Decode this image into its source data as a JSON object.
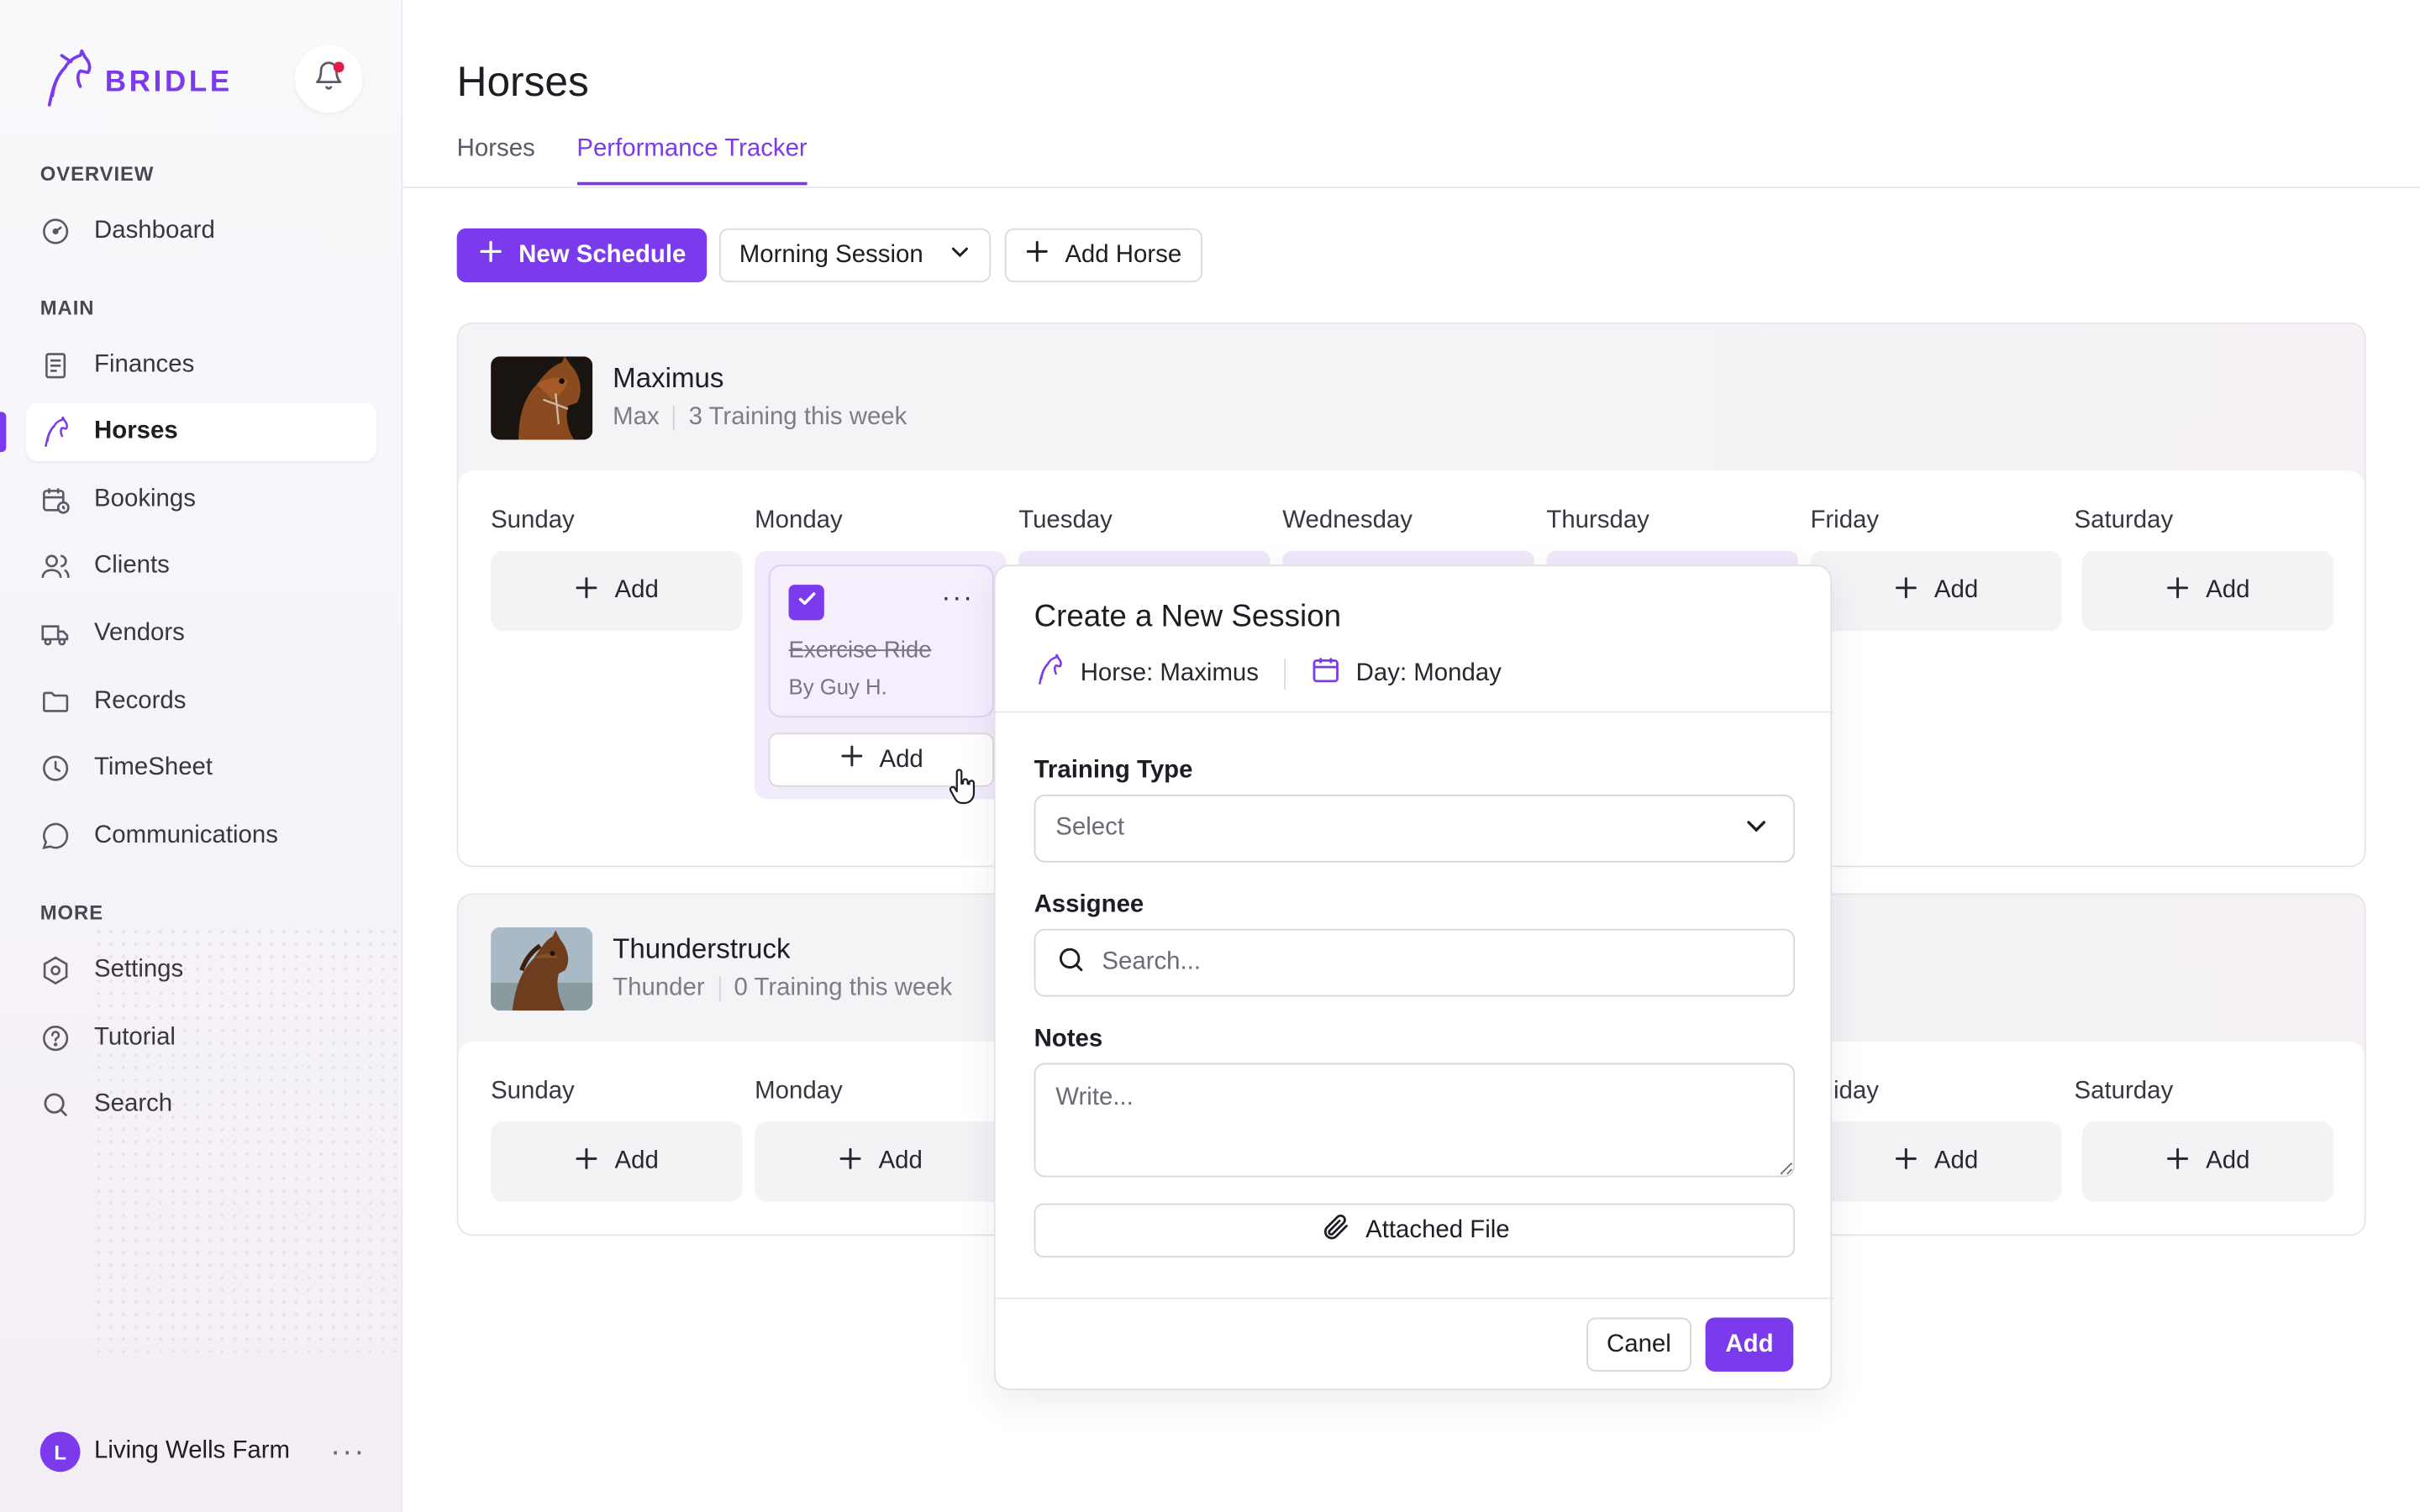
{
  "brand": {
    "name": "BRIDLE",
    "logo_icon": "horse-head-icon"
  },
  "sidebar": {
    "sections": {
      "overview": "OVERVIEW",
      "main": "MAIN",
      "more": "MORE"
    },
    "items": [
      {
        "label": "Dashboard",
        "icon": "gauge-icon"
      },
      {
        "label": "Finances",
        "icon": "receipt-icon"
      },
      {
        "label": "Horses",
        "icon": "horse-head-icon",
        "active": true
      },
      {
        "label": "Bookings",
        "icon": "calendar-clock-icon"
      },
      {
        "label": "Clients",
        "icon": "users-icon"
      },
      {
        "label": "Vendors",
        "icon": "truck-icon"
      },
      {
        "label": "Records",
        "icon": "folder-icon"
      },
      {
        "label": "TimeSheet",
        "icon": "clock-icon"
      },
      {
        "label": "Communications",
        "icon": "chat-bubble-icon"
      },
      {
        "label": "Settings",
        "icon": "gear-icon"
      },
      {
        "label": "Tutorial",
        "icon": "help-circle-icon"
      },
      {
        "label": "Search",
        "icon": "search-icon"
      }
    ],
    "account": {
      "initial": "L",
      "name": "Living Wells Farm",
      "more": "···"
    }
  },
  "header": {
    "title": "Horses",
    "tabs": [
      {
        "label": "Horses"
      },
      {
        "label": "Performance Tracker",
        "active": true
      }
    ]
  },
  "toolbar": {
    "new_schedule": "New Schedule",
    "session_select": "Morning Session",
    "add_horse": "Add Horse"
  },
  "days": [
    "Sunday",
    "Monday",
    "Tuesday",
    "Wednesday",
    "Thursday",
    "Friday",
    "Saturday"
  ],
  "days_partial": {
    "friday_cut": "iday"
  },
  "add_label": "Add",
  "horses": [
    {
      "name": "Maximus",
      "nickname": "Max",
      "training": "3 Training this week"
    },
    {
      "name": "Thunderstruck",
      "nickname": "Thunder",
      "training": "0 Training this week"
    }
  ],
  "session": {
    "title": "Exercise Ride",
    "by": "By Guy H.",
    "more": "···"
  },
  "modal": {
    "title": "Create a New Session",
    "horse": "Horse: Maximus",
    "day": "Day: Monday",
    "training_type_label": "Training Type",
    "training_type_value": "Select",
    "assignee_label": "Assignee",
    "assignee_placeholder": "Search...",
    "notes_label": "Notes",
    "notes_placeholder": "Write...",
    "attach_label": "Attached File",
    "cancel": "Canel",
    "add": "Add"
  },
  "colors": {
    "accent": "#7c3aed",
    "badge": "#e11d48"
  }
}
